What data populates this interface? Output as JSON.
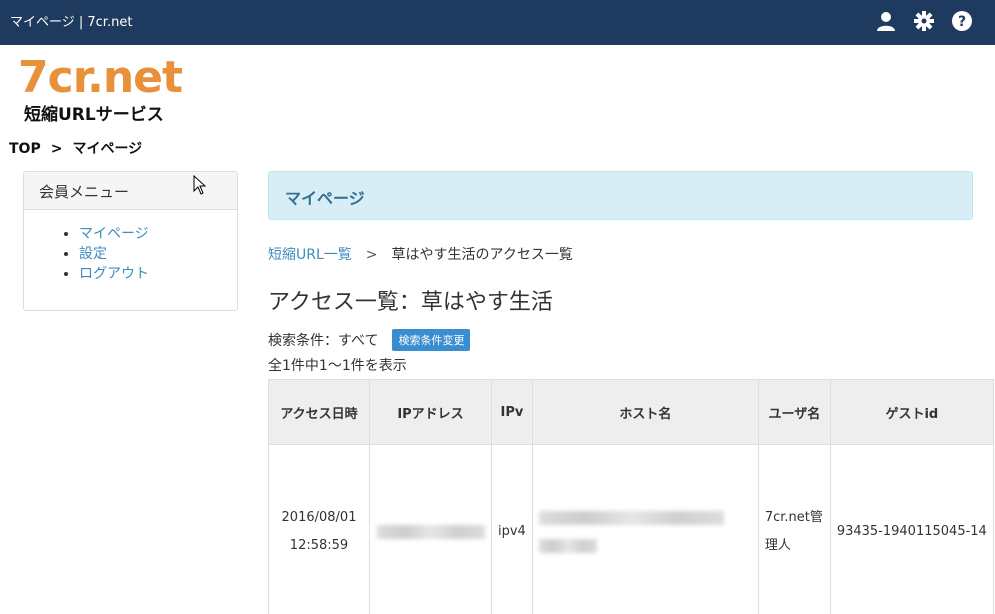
{
  "topbar": {
    "title": "マイページ | 7cr.net",
    "icons": [
      "user-icon",
      "gear-icon",
      "help-icon"
    ]
  },
  "logo": {
    "main": "7cr.net",
    "sub": "短縮URLサービス"
  },
  "breadcrumb": {
    "top": "TOP",
    "sep": ">",
    "current": "マイページ"
  },
  "sidebar": {
    "heading": "会員メニュー",
    "items": [
      {
        "label": "マイページ"
      },
      {
        "label": "設定"
      },
      {
        "label": "ログアウト"
      }
    ]
  },
  "main": {
    "panel_title": "マイページ",
    "crumb_link": "短縮URL一覧",
    "crumb_sep": ">",
    "crumb_current": "草はやす生活のアクセス一覧",
    "heading": "アクセス一覧：草はやす生活",
    "condition_label": "検索条件：すべて",
    "condition_button": "検索条件変更",
    "count_text": "全1件中1～1件を表示"
  },
  "table": {
    "headers": [
      "アクセス日時",
      "IPアドレス",
      "IPv",
      "ホスト名",
      "ユーザ名",
      "ゲストid"
    ],
    "row": {
      "date": "2016/08/01",
      "time": "12:58:59",
      "ipv": "ipv4",
      "user_line1": "7cr.net管",
      "user_line2": "理人",
      "guest_id": "93435-1940115045-14"
    }
  },
  "colors": {
    "topbar": "#1f3a5f",
    "logo": "#e8913a",
    "link": "#3b8dbd",
    "panel_bg": "#d9edf7",
    "button": "#3b8dd1"
  }
}
